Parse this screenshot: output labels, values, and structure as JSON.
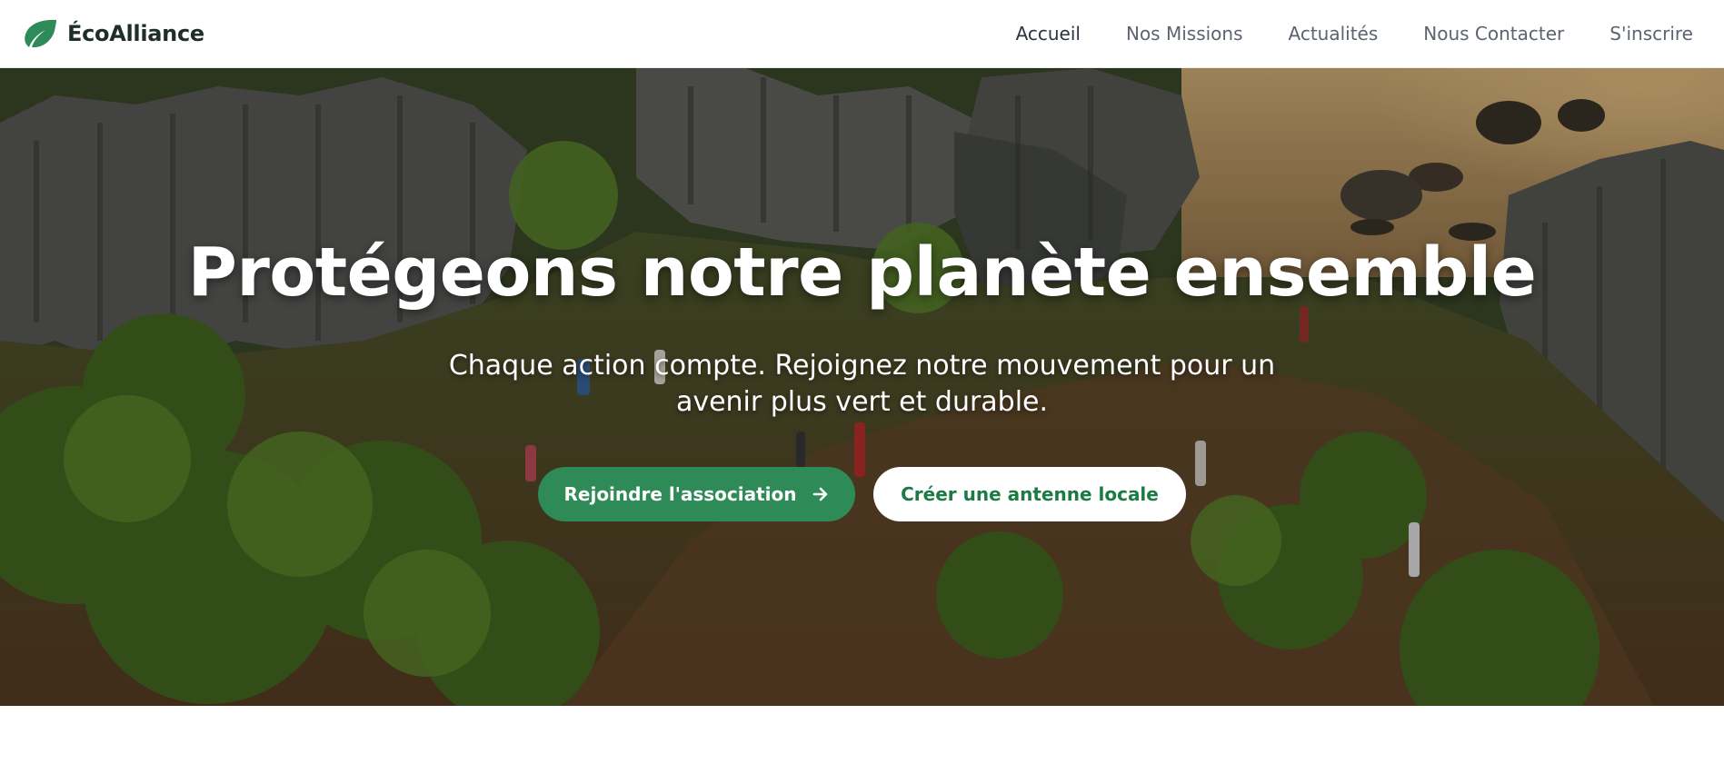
{
  "brand": {
    "name": "ÉcoAlliance",
    "logo_icon": "leaf-icon",
    "logo_color": "#2e8b57"
  },
  "nav": {
    "items": [
      {
        "label": "Accueil",
        "active": true
      },
      {
        "label": "Nos Missions",
        "active": false
      },
      {
        "label": "Actualités",
        "active": false
      },
      {
        "label": "Nous Contacter",
        "active": false
      },
      {
        "label": "S'inscrire",
        "active": false
      }
    ]
  },
  "hero": {
    "title": "Protégeons notre planète ensemble",
    "subtitle": "Chaque action compte. Rejoignez notre mouvement pour un avenir plus vert et durable.",
    "primary_button": {
      "label": "Rejoindre l'association",
      "icon": "arrow-right-icon"
    },
    "secondary_button": {
      "label": "Créer une antenne locale"
    },
    "background_image": "volunteers cleaning a green coastal landscape with limestone rock formations"
  },
  "colors": {
    "accent": "#2e8b57",
    "secondary_text": "#1d7a45",
    "nav_text": "#5b6470"
  }
}
